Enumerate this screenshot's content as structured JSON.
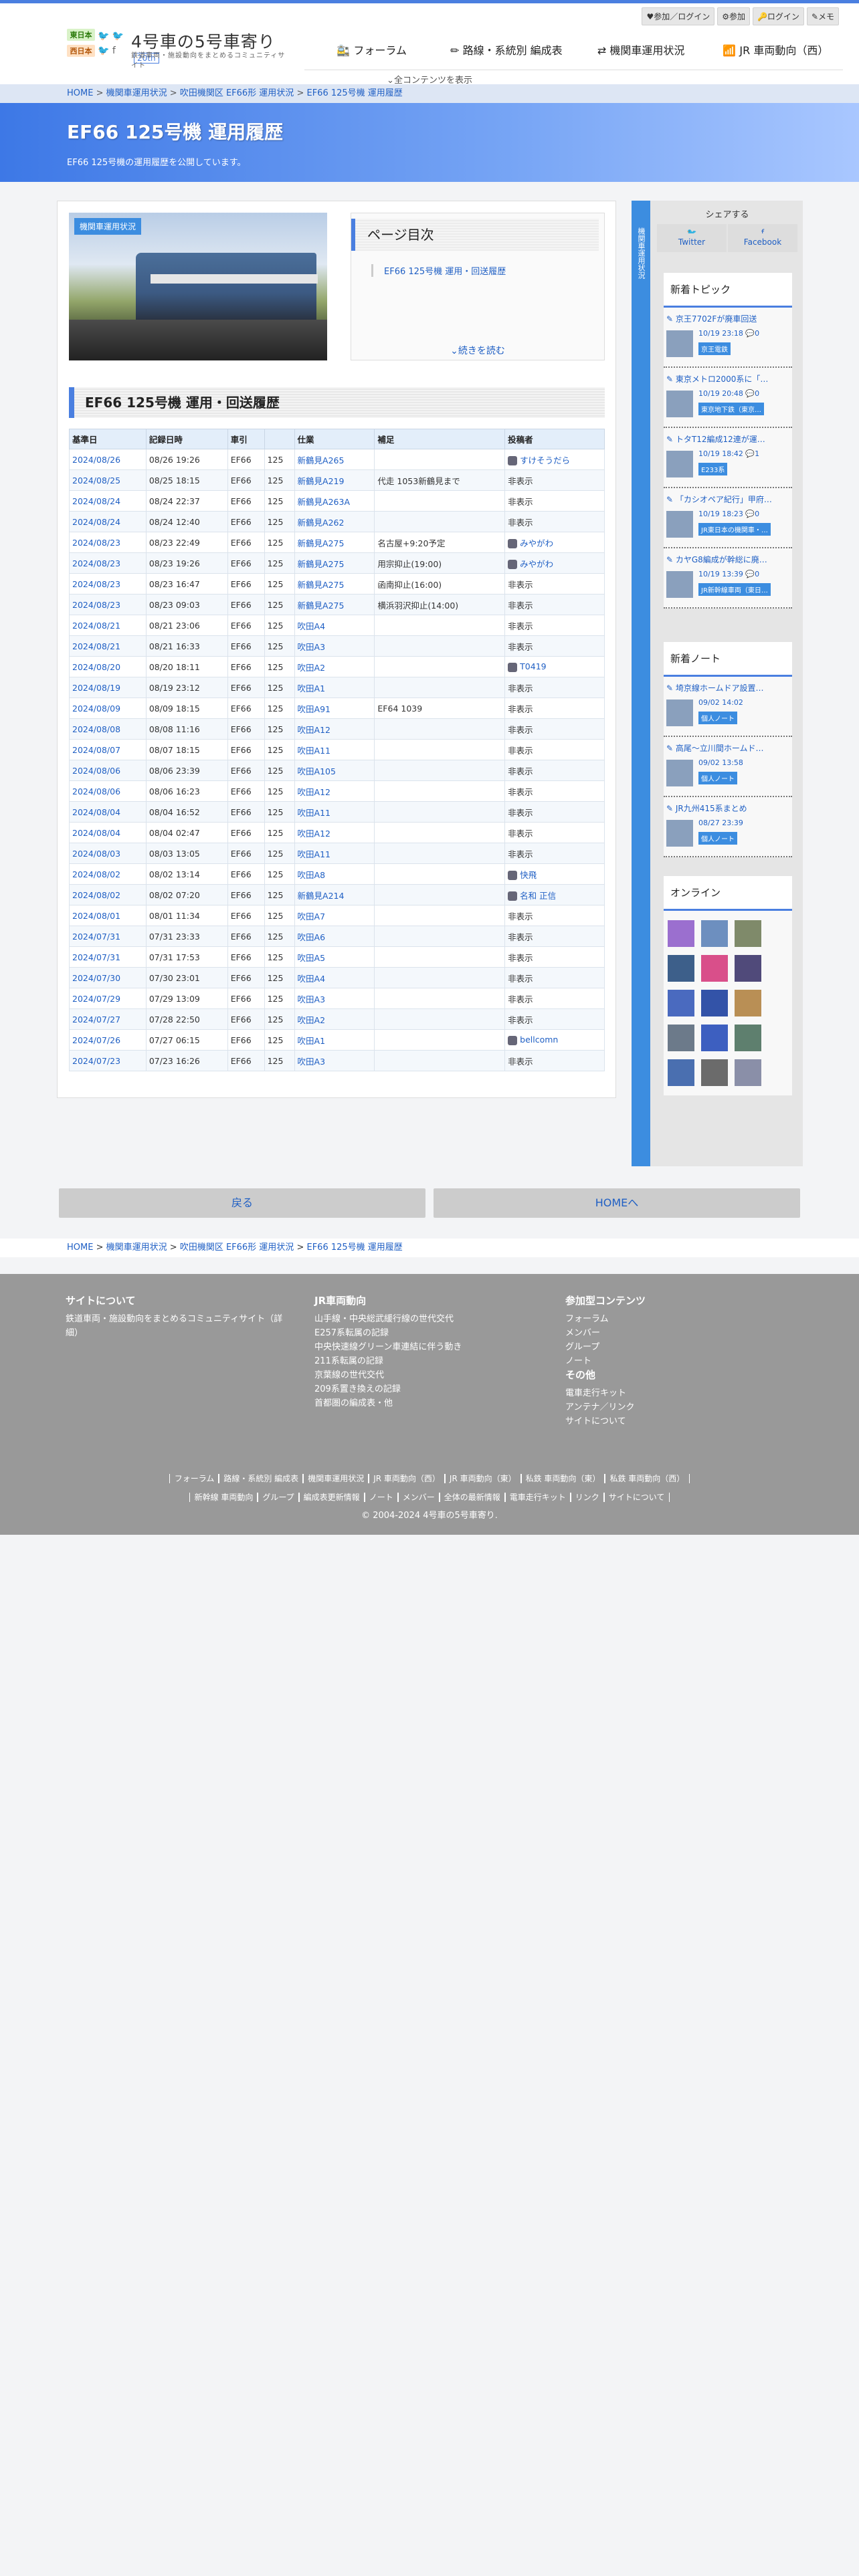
{
  "header": {
    "tag_east": "東日本",
    "tag_west": "西日本",
    "site_title": "4号車の5号車寄り",
    "badge": "20th",
    "subtitle": "鉄道車両・施設動向をまとめるコミュニティサイト",
    "userbar": [
      "♥参加／ログイン",
      "⚙参加",
      "🔑ログイン",
      "✎メモ"
    ],
    "nav": [
      "🚉 フォーラム",
      "✏ 路線・系統別 編成表",
      "⇄ 機関車運用状況",
      "📶 JR 車両動向（西）"
    ],
    "all_contents": "⌄全コンテンツを表示"
  },
  "breadcrumb": [
    "HOME",
    "機関車運用状況",
    "吹田機関区 EF66形 運用状況",
    "EF66 125号機 運用履歴"
  ],
  "hero": {
    "title": "EF66 125号機 運用履歴",
    "desc": "EF66 125号機の運用履歴を公開しています。"
  },
  "photo_label": "機関車運用状況",
  "toc": {
    "heading": "ページ目次",
    "item": "EF66 125号機 運用・回送履歴",
    "more": "⌄続きを読む"
  },
  "section_title": "EF66 125号機 運用・回送履歴",
  "table": {
    "headers": [
      "基準日",
      "記録日時",
      "車引",
      "",
      "仕業",
      "補足",
      "投稿者"
    ],
    "rows": [
      [
        "2024/08/26",
        "08/26 19:26",
        "EF66",
        "125",
        "新鶴見A265",
        "",
        "すけそうだら"
      ],
      [
        "2024/08/25",
        "08/25 18:15",
        "EF66",
        "125",
        "新鶴見A219",
        "代走 1053新鶴見まで",
        "非表示"
      ],
      [
        "2024/08/24",
        "08/24 22:37",
        "EF66",
        "125",
        "新鶴見A263A",
        "",
        "非表示"
      ],
      [
        "2024/08/24",
        "08/24 12:40",
        "EF66",
        "125",
        "新鶴見A262",
        "",
        "非表示"
      ],
      [
        "2024/08/23",
        "08/23 22:49",
        "EF66",
        "125",
        "新鶴見A275",
        "名古屋+9:20予定",
        "みやがわ"
      ],
      [
        "2024/08/23",
        "08/23 19:26",
        "EF66",
        "125",
        "新鶴見A275",
        "用宗抑止(19:00)",
        "みやがわ"
      ],
      [
        "2024/08/23",
        "08/23 16:47",
        "EF66",
        "125",
        "新鶴見A275",
        "函南抑止(16:00)",
        "非表示"
      ],
      [
        "2024/08/23",
        "08/23 09:03",
        "EF66",
        "125",
        "新鶴見A275",
        "横浜羽沢抑止(14:00)",
        "非表示"
      ],
      [
        "2024/08/21",
        "08/21 23:06",
        "EF66",
        "125",
        "吹田A4",
        "",
        "非表示"
      ],
      [
        "2024/08/21",
        "08/21 16:33",
        "EF66",
        "125",
        "吹田A3",
        "",
        "非表示"
      ],
      [
        "2024/08/20",
        "08/20 18:11",
        "EF66",
        "125",
        "吹田A2",
        "",
        "T0419"
      ],
      [
        "2024/08/19",
        "08/19 23:12",
        "EF66",
        "125",
        "吹田A1",
        "",
        "非表示"
      ],
      [
        "2024/08/09",
        "08/09 18:15",
        "EF66",
        "125",
        "吹田A91",
        "EF64 1039",
        "非表示"
      ],
      [
        "2024/08/08",
        "08/08 11:16",
        "EF66",
        "125",
        "吹田A12",
        "",
        "非表示"
      ],
      [
        "2024/08/07",
        "08/07 18:15",
        "EF66",
        "125",
        "吹田A11",
        "",
        "非表示"
      ],
      [
        "2024/08/06",
        "08/06 23:39",
        "EF66",
        "125",
        "吹田A105",
        "",
        "非表示"
      ],
      [
        "2024/08/06",
        "08/06 16:23",
        "EF66",
        "125",
        "吹田A12",
        "",
        "非表示"
      ],
      [
        "2024/08/04",
        "08/04 16:52",
        "EF66",
        "125",
        "吹田A11",
        "",
        "非表示"
      ],
      [
        "2024/08/04",
        "08/04 02:47",
        "EF66",
        "125",
        "吹田A12",
        "",
        "非表示"
      ],
      [
        "2024/08/03",
        "08/03 13:05",
        "EF66",
        "125",
        "吹田A11",
        "",
        "非表示"
      ],
      [
        "2024/08/02",
        "08/02 13:14",
        "EF66",
        "125",
        "吹田A8",
        "",
        "快飛"
      ],
      [
        "2024/08/02",
        "08/02 07:20",
        "EF66",
        "125",
        "新鶴見A214",
        "",
        "名和 正信"
      ],
      [
        "2024/08/01",
        "08/01 11:34",
        "EF66",
        "125",
        "吹田A7",
        "",
        "非表示"
      ],
      [
        "2024/07/31",
        "07/31 23:33",
        "EF66",
        "125",
        "吹田A6",
        "",
        "非表示"
      ],
      [
        "2024/07/31",
        "07/31 17:53",
        "EF66",
        "125",
        "吹田A5",
        "",
        "非表示"
      ],
      [
        "2024/07/30",
        "07/30 23:01",
        "EF66",
        "125",
        "吹田A4",
        "",
        "非表示"
      ],
      [
        "2024/07/29",
        "07/29 13:09",
        "EF66",
        "125",
        "吹田A3",
        "",
        "非表示"
      ],
      [
        "2024/07/27",
        "07/28 22:50",
        "EF66",
        "125",
        "吹田A2",
        "",
        "非表示"
      ],
      [
        "2024/07/26",
        "07/27 06:15",
        "EF66",
        "125",
        "吹田A1",
        "",
        "bellcomn"
      ],
      [
        "2024/07/23",
        "07/23 16:26",
        "EF66",
        "125",
        "吹田A3",
        "",
        "非表示"
      ]
    ]
  },
  "side": {
    "strip_text": "機関車運用状況",
    "share_title": "シェアする",
    "share_buttons": [
      "Twitter",
      "Facebook"
    ],
    "topics_title": "新着トピック",
    "topics": [
      {
        "title": "京王7702Fが廃車回送",
        "meta": "10/19 23:18 💬0",
        "cat": "京王電鉄"
      },
      {
        "title": "東京メトロ2000系に「…",
        "meta": "10/19 20:48 💬0",
        "cat": "東京地下鉄（東京…"
      },
      {
        "title": "トタT12編成12連が運…",
        "meta": "10/19 18:42 💬1",
        "cat": "E233系"
      },
      {
        "title": "「カシオペア紀行」甲府…",
        "meta": "10/19 18:23 💬0",
        "cat": "JR東日本の機関車・…"
      },
      {
        "title": "カヤG8編成が幹総に廃…",
        "meta": "10/19 13:39 💬0",
        "cat": "JR新幹線車両（東日…"
      }
    ],
    "notes_title": "新着ノート",
    "notes": [
      {
        "title": "埼京線ホームドア設置…",
        "meta": "09/02 14:02",
        "cat": "個人ノート"
      },
      {
        "title": "高尾〜立川間ホームド…",
        "meta": "09/02 13:58",
        "cat": "個人ノート"
      },
      {
        "title": "JR九州415系まとめ",
        "meta": "08/27 23:39",
        "cat": "個人ノート"
      }
    ],
    "online_title": "オンライン"
  },
  "buttons": {
    "back": "戻る",
    "home": "HOMEへ"
  },
  "footer": {
    "about_title": "サイトについて",
    "about_text": "鉄道車両・施設動向をまとめるコミュニティサイト（詳細）",
    "jr_title": "JR車両動向",
    "jr_items": [
      "山手線・中央総武緩行線の世代交代",
      "E257系転属の記録",
      "中央快速線グリーン車連結に伴う動き",
      "211系転属の記録",
      "京葉線の世代交代",
      "209系置き換えの記録",
      "首都圏の編成表・他"
    ],
    "community_title": "参加型コンテンツ",
    "community_items": [
      "フォーラム",
      "メンバー",
      "グループ",
      "ノート"
    ],
    "other_title": "その他",
    "other_items": [
      "電車走行キット",
      "アンテナ／リンク",
      "サイトについて"
    ],
    "nav_row1": [
      "フォーラム",
      "路線・系統別 編成表",
      "機関車運用状況",
      "JR 車両動向（西）",
      "JR 車両動向（東）",
      "私鉄 車両動向（東）",
      "私鉄 車両動向（西）"
    ],
    "nav_row2": [
      "新幹線 車両動向",
      "グループ",
      "編成表更新情報",
      "ノート",
      "メンバー",
      "全体の最新情報",
      "電車走行キット",
      "リンク",
      "サイトについて"
    ],
    "copyright": "© 2004-2024 4号車の5号車寄り."
  }
}
